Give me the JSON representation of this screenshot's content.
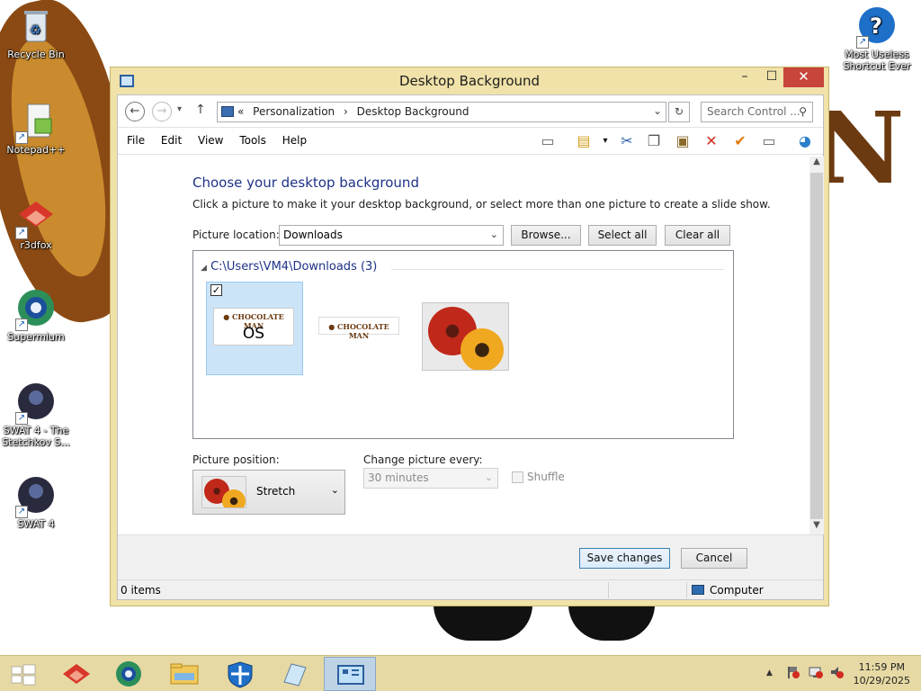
{
  "desktop": {
    "icons": [
      {
        "label": "Recycle Bin",
        "icon": "recycle-bin-icon"
      },
      {
        "label": "Notepad++",
        "icon": "notepad-icon"
      },
      {
        "label": "r3dfox",
        "icon": "r3dfox-icon"
      },
      {
        "label": "Supermium",
        "icon": "supermium-icon"
      },
      {
        "label": "SWAT 4 - The Stetchkov S...",
        "icon": "swat4-stetchkov-icon"
      },
      {
        "label": "SWAT 4",
        "icon": "swat4-icon"
      },
      {
        "label": "Most Useless Shortcut Ever",
        "icon": "help-question-icon"
      }
    ]
  },
  "window": {
    "title": "Desktop Background",
    "controls": {
      "minimize": "–",
      "maximize": "☐",
      "close": "✕"
    }
  },
  "address": {
    "prefix": "«",
    "crumbs": [
      "Personalization",
      "Desktop Background"
    ],
    "search_placeholder": "Search Control ..."
  },
  "menu": [
    "File",
    "Edit",
    "View",
    "Tools",
    "Help"
  ],
  "page": {
    "heading": "Choose your desktop background",
    "subtitle": "Click a picture to make it your desktop background, or select more than one picture to create a slide show.",
    "picture_location_label": "Picture location:",
    "picture_location_value": "Downloads",
    "browse_button": "Browse...",
    "select_all_button": "Select all",
    "clear_all_button": "Clear all",
    "group_header": "C:\\Users\\VM4\\Downloads (3)",
    "thumbnails": [
      {
        "name": "chocolate-man-os",
        "logo": "Chocolate Man",
        "caption": "OS",
        "selected": true
      },
      {
        "name": "chocolate-man",
        "logo": "Chocolate Man",
        "selected": false
      },
      {
        "name": "flowers",
        "selected": false
      }
    ],
    "picture_position_label": "Picture position:",
    "picture_position_value": "Stretch",
    "change_every_label": "Change picture every:",
    "change_every_value": "30 minutes",
    "shuffle_label": "Shuffle",
    "save_button": "Save changes",
    "cancel_button": "Cancel"
  },
  "status": {
    "items": "0 items",
    "location": "Computer"
  },
  "taskbar": {
    "time": "11:59 PM",
    "date": "10/29/2025",
    "tray_chevron": "▲"
  },
  "colors": {
    "window_frame": "#f0e2a8",
    "heading_blue": "#1e3287",
    "close_red": "#c7453a",
    "selection_blue": "#cce4f7",
    "taskbar": "#e6d9a4"
  }
}
